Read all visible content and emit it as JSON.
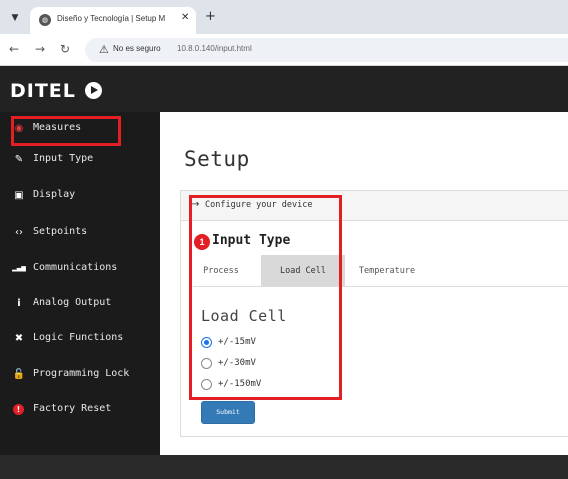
{
  "browser": {
    "tab_title": "Diseño y Tecnología | Setup M",
    "tab_close": "✕",
    "new_tab": "+",
    "security_label": "No es seguro",
    "url": "10.8.0.140/input.html",
    "back_icon": "arrow-left-icon",
    "forward_icon": "arrow-right-icon",
    "reload_icon": "reload-icon"
  },
  "header": {
    "logo_text": "DITEL"
  },
  "sidebar": {
    "items": [
      {
        "label": "Measures",
        "icon": "dashboard-icon",
        "glyph": "◉",
        "active": true
      },
      {
        "label": "Input Type",
        "icon": "wrench-icon",
        "glyph": "✎"
      },
      {
        "label": "Display",
        "icon": "camera-icon",
        "glyph": "▣"
      },
      {
        "label": "Setpoints",
        "icon": "code-icon",
        "glyph": "‹›"
      },
      {
        "label": "Communications",
        "icon": "signal-icon",
        "glyph": "▂▄▆"
      },
      {
        "label": "Analog Output",
        "icon": "info-icon",
        "glyph": "i"
      },
      {
        "label": "Logic Functions",
        "icon": "puzzle-icon",
        "glyph": "✖"
      },
      {
        "label": "Programming Lock",
        "icon": "unlock-icon",
        "glyph": "🔓"
      },
      {
        "label": "Factory Reset",
        "icon": "alert-icon",
        "glyph": "!"
      }
    ]
  },
  "main": {
    "title": "Setup",
    "card_header": "Configure your device",
    "step_number": "1",
    "section_title": "Input Type",
    "tabs": [
      {
        "label": "Process",
        "active": false
      },
      {
        "label": "Load Cell",
        "active": true
      },
      {
        "label": "Temperature",
        "active": false
      }
    ],
    "load_title": "Load Cell",
    "options": [
      {
        "label": "+/-15mV",
        "checked": true
      },
      {
        "label": "+/-30mV",
        "checked": false
      },
      {
        "label": "+/-150mV",
        "checked": false
      }
    ],
    "submit_label": "Submit"
  },
  "colors": {
    "accent": "#337ab7",
    "highlight": "#e31e24",
    "sidebar_bg": "#1b1b1b",
    "header_bg": "#222222"
  }
}
